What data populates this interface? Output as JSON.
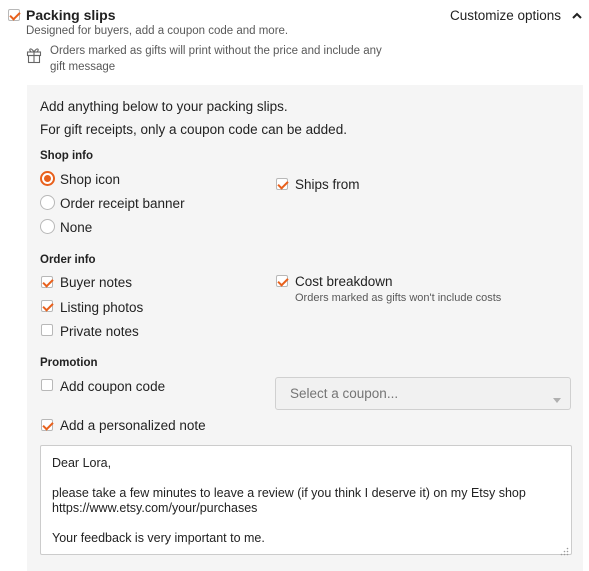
{
  "header": {
    "title": "Packing slips",
    "subtitle": "Designed for buyers, add a coupon code and more.",
    "gift_note_line1": "Orders marked as gifts will print without the price and include any",
    "gift_note_line2": "gift message",
    "customize_label": "Customize options",
    "enabled": true
  },
  "intro": {
    "line1": "Add anything below to your packing slips.",
    "line2": "For gift receipts, only a coupon code can be added."
  },
  "shop_info": {
    "heading": "Shop info",
    "options": [
      {
        "label": "Shop icon",
        "selected": true
      },
      {
        "label": "Order receipt banner",
        "selected": false
      },
      {
        "label": "None",
        "selected": false
      }
    ],
    "ships_from": {
      "label": "Ships from",
      "checked": true
    }
  },
  "order_info": {
    "heading": "Order info",
    "items": [
      {
        "label": "Buyer notes",
        "checked": true
      },
      {
        "label": "Listing photos",
        "checked": true
      },
      {
        "label": "Private notes",
        "checked": false
      }
    ],
    "cost_breakdown": {
      "label": "Cost breakdown",
      "checked": true,
      "note": "Orders marked as gifts won't include costs"
    }
  },
  "promotion": {
    "heading": "Promotion",
    "coupon": {
      "label": "Add coupon code",
      "checked": false
    },
    "coupon_select_placeholder": "Select a coupon...",
    "personal_note": {
      "label": "Add a personalized note",
      "checked": true
    },
    "note_text": "Dear Lora,\n\nplease take a few minutes to leave a review (if you think I deserve it) on my Etsy shop\nhttps://www.etsy.com/your/purchases\n\nYour feedback is very important to me."
  },
  "colors": {
    "accent": "#e8601c",
    "panel": "#f5f5f5"
  }
}
